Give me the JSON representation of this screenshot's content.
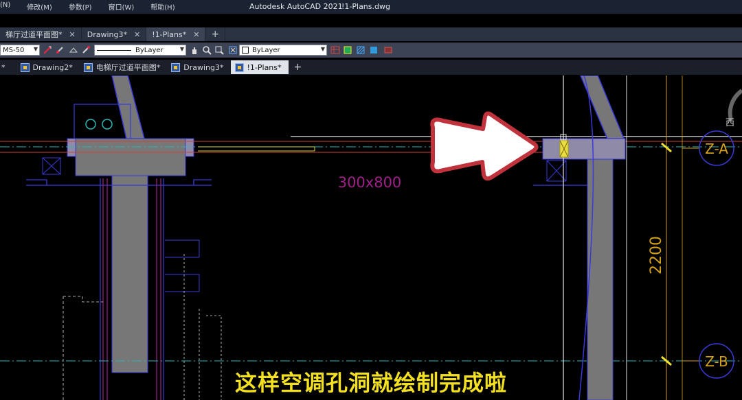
{
  "app": {
    "title": "Autodesk AutoCAD 2021",
    "file": "!1-Plans.dwg"
  },
  "menu": [
    "(N)",
    "修改(M)",
    "参数(P)",
    "窗口(W)",
    "帮助(H)"
  ],
  "file_tabs": [
    {
      "label": "梯厅过道平面图*",
      "active": false
    },
    {
      "label": "Drawing3*",
      "active": false
    },
    {
      "label": "!1-Plans*",
      "active": true
    }
  ],
  "toolbar": {
    "dimstyle": "MS-50",
    "linetype": "ByLayer",
    "color": "ByLayer"
  },
  "doc_tabs": [
    {
      "label": "*",
      "active": false
    },
    {
      "label": "Drawing2*",
      "active": false
    },
    {
      "label": "电梯厅过道平面图*",
      "active": false
    },
    {
      "label": "Drawing3*",
      "active": false
    },
    {
      "label": "!1-Plans*",
      "active": true
    }
  ],
  "drawing": {
    "opening_label": "300x800",
    "dimension": "2200",
    "grid_a": "Z-A",
    "grid_b": "Z-B",
    "viewcube_label": "西",
    "colors": {
      "wall": "#777777",
      "outline": "#3a3ad8",
      "axis": "#2ab8b8",
      "dim": "#d4a017",
      "label": "#a0208a",
      "arrow": "#c0323c"
    }
  },
  "subtitle": "这样空调孔洞就绘制完成啦"
}
